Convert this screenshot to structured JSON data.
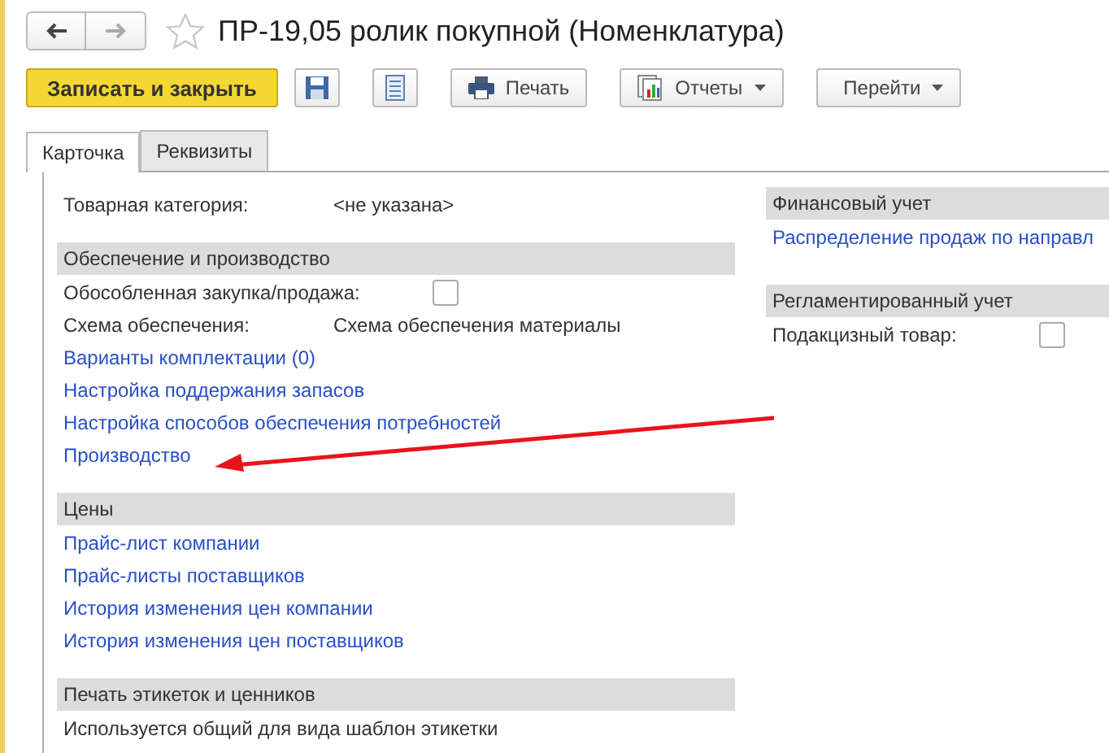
{
  "window": {
    "title": "ПР-19,05 ролик покупной (Номенклатура)",
    "favorite": false
  },
  "nav": {
    "back_disabled": false,
    "forward_disabled": true
  },
  "toolbar": [
    {
      "kind": "primary",
      "label": "Записать и закрыть"
    },
    {
      "kind": "save"
    },
    {
      "kind": "list"
    },
    {
      "kind": "print",
      "label": "Печать"
    },
    {
      "kind": "reports",
      "label": "Отчеты"
    },
    {
      "kind": "menu",
      "label": "Перейти"
    }
  ],
  "tabs": [
    {
      "label": "Карточка",
      "selected": true
    },
    {
      "label": "Реквизиты",
      "selected": false
    }
  ],
  "left_sections": [
    {
      "items": [
        {
          "kind": "field",
          "label": "Товарная категория:",
          "value": "<не указана>"
        }
      ]
    },
    {
      "title": "Обеспечение и производство",
      "items": [
        {
          "kind": "checkbox",
          "label": "Обособленная закупка/продажа:",
          "checked": false
        },
        {
          "kind": "field",
          "label": "Схема обеспечения:",
          "value": "Схема обеспечения материалы"
        },
        {
          "kind": "link",
          "label": "Варианты комплектации (0)"
        },
        {
          "kind": "link",
          "label": "Настройка поддержания запасов"
        },
        {
          "kind": "link",
          "label": "Настройка способов обеспечения потребностей"
        },
        {
          "kind": "link",
          "label": "Производство"
        }
      ]
    },
    {
      "title": "Цены",
      "items": [
        {
          "kind": "link",
          "label": "Прайс-лист компании"
        },
        {
          "kind": "link",
          "label": "Прайс-листы поставщиков"
        },
        {
          "kind": "link",
          "label": "История изменения цен компании"
        },
        {
          "kind": "link",
          "label": "История изменения цен поставщиков"
        }
      ]
    },
    {
      "title": "Печать этикеток и ценников",
      "items": [
        {
          "kind": "text",
          "label": "Используется общий для вида шаблон этикетки"
        }
      ]
    }
  ],
  "right_sections": [
    {
      "title": "Финансовый учет",
      "items": [
        {
          "kind": "link",
          "label": "Распределение продаж по направл"
        }
      ]
    },
    {
      "title": "Регламентированный учет",
      "items": [
        {
          "kind": "checkbox",
          "label": "Подакцизный товар:",
          "checked": false
        }
      ]
    }
  ]
}
